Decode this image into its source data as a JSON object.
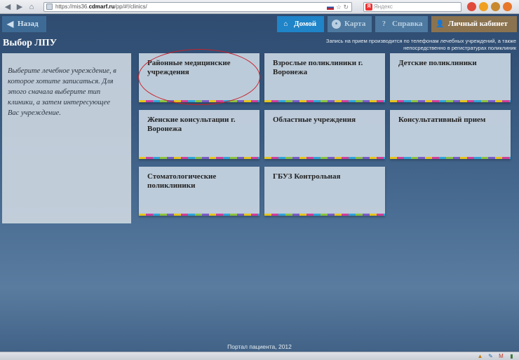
{
  "browser": {
    "url_prefix": "https://mis36.",
    "url_host": "cdmarf.ru",
    "url_path": "/pp/#!/clinics/",
    "search_placeholder": "Яндекс"
  },
  "toolbar": {
    "back_label": "Назад",
    "home_label": "Домой",
    "map_label": "Карта",
    "help_label": "Справка",
    "cabinet_label": "Личный кабинет"
  },
  "page": {
    "title": "Выбор ЛПУ",
    "notice_line1": "Запись на прием производится по телефонам лечебных учреждений, а также",
    "notice_line2": "непосредственно в регистратурах поликлиник"
  },
  "side_panel": {
    "text": "Выберите лечебное учреждение, в которое хотите записаться. Для этого сначала выберите тип клиники, а затем интересующее Вас учреждение."
  },
  "tiles": [
    {
      "label": "Районные медицинские учреждения"
    },
    {
      "label": "Взрослые поликлиники г. Воронежа"
    },
    {
      "label": "Детские поликлиники"
    },
    {
      "label": "Женские консультации г. Воронежа"
    },
    {
      "label": "Областные учреждения"
    },
    {
      "label": "Консультативный прием"
    },
    {
      "label": "Стоматологические поликлиники"
    },
    {
      "label": "ГБУЗ Контрольная"
    }
  ],
  "footer": {
    "text": "Портал пациента, 2012"
  },
  "colors": {
    "home_tab": "#1f84c8",
    "cabinet_tab": "#8b7350",
    "highlight": "#c8202a"
  }
}
